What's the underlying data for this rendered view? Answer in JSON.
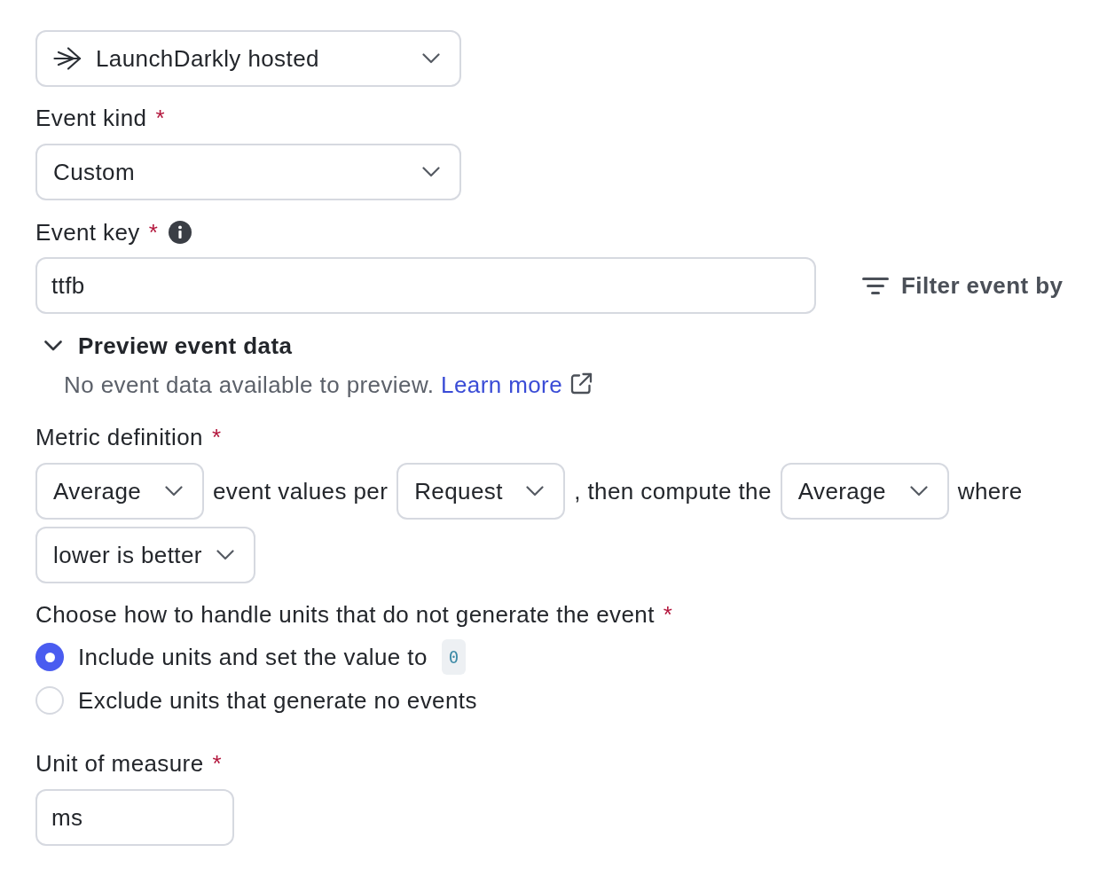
{
  "source_select": {
    "value": "LaunchDarkly hosted"
  },
  "event_kind": {
    "label": "Event kind",
    "required_mark": "*",
    "value": "Custom"
  },
  "event_key": {
    "label": "Event key",
    "required_mark": "*",
    "value": "ttfb"
  },
  "filter_button": {
    "label": "Filter event by"
  },
  "preview": {
    "title": "Preview event data",
    "expanded": true,
    "message": "No event data available to preview.",
    "link": "Learn more"
  },
  "metric_definition": {
    "label": "Metric definition",
    "required_mark": "*",
    "parts": [
      {
        "kind": "select",
        "value": "Average"
      },
      {
        "kind": "text",
        "text": "event values per"
      },
      {
        "kind": "select",
        "value": "Request"
      },
      {
        "kind": "text",
        "text": ", then compute the"
      },
      {
        "kind": "select",
        "value": "Average"
      },
      {
        "kind": "text",
        "text": "where"
      },
      {
        "kind": "select",
        "value": "lower is better"
      }
    ]
  },
  "units_handling": {
    "label": "Choose how to handle units that do not generate the event",
    "required_mark": "*",
    "options": [
      {
        "label": "Include units and set the value to",
        "code": "0",
        "selected": true
      },
      {
        "label": "Exclude units that generate no events",
        "selected": false
      }
    ]
  },
  "unit_of_measure": {
    "label": "Unit of measure",
    "required_mark": "*",
    "value": "ms"
  }
}
